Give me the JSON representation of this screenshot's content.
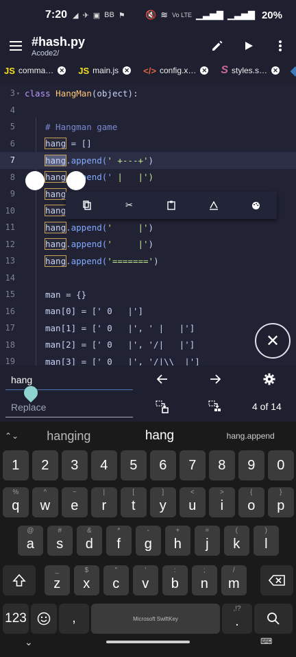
{
  "status": {
    "time": "7:20",
    "left_icons": [
      "◢",
      "✈",
      "▣",
      "ВВ",
      "⚑"
    ],
    "right_small": "Vo LTE",
    "battery": "20%"
  },
  "appbar": {
    "title": "#hash.py",
    "path": "Acode2/"
  },
  "tabs": [
    {
      "icon": "JS",
      "label": "comma…",
      "color": "#f7df1e"
    },
    {
      "icon": "JS",
      "label": "main.js",
      "color": "#f7df1e"
    },
    {
      "icon": "</>",
      "label": "config.x…",
      "color": "#e8603c"
    },
    {
      "icon": "S",
      "label": "styles.s…",
      "color": "#cd6799"
    },
    {
      "icon": "◆",
      "label": "",
      "color": "#3d7ab8"
    }
  ],
  "editor": {
    "lines": [
      {
        "n": "3",
        "fold": "▾"
      },
      {
        "n": "4"
      },
      {
        "n": "5"
      },
      {
        "n": "6"
      },
      {
        "n": "7"
      },
      {
        "n": "8"
      },
      {
        "n": "9"
      },
      {
        "n": "10"
      },
      {
        "n": "11"
      },
      {
        "n": "12"
      },
      {
        "n": "13"
      },
      {
        "n": "14"
      },
      {
        "n": "15"
      },
      {
        "n": "16"
      },
      {
        "n": "17"
      },
      {
        "n": "18"
      },
      {
        "n": "19"
      }
    ],
    "code": {
      "l3_kw": "class",
      "l3_cls": "HangMan",
      "l3_rest": "(object):",
      "l5": "# Hangman game",
      "hang": "hang",
      "l6_rest": " = []",
      "append": ".append(",
      "s7": "' +---+'",
      "s8_a": "' |   |'",
      "s8_hidden": "end('",
      "s8_tail": " |   |')",
      "s11": "'     |'",
      "s12": "'     |'",
      "s13": "'======='",
      "close": ")",
      "l15": "man = {}",
      "l16": "man[0] = [' 0   |']",
      "l17": "man[1] = [' 0   |', ' |   |']",
      "l18": "man[2] = [' 0   |', '/|   |']",
      "l19": "man[3] = [' 0   |', '/|\\\\  |']"
    }
  },
  "context_toolbar": {
    "items": [
      {
        "name": "copy-icon",
        "glyph": "⧉"
      },
      {
        "name": "cut-icon",
        "glyph": "✂"
      },
      {
        "name": "paste-icon",
        "glyph": "📋"
      },
      {
        "name": "select-all-icon",
        "glyph": "A"
      },
      {
        "name": "palette-icon",
        "glyph": "◕"
      }
    ]
  },
  "search": {
    "find_value": "hang",
    "replace_placeholder": "Replace",
    "match_count": "4 of 14"
  },
  "keyboard": {
    "suggestions": [
      "hanging",
      "hang",
      "hang.append"
    ],
    "brand": "Microsoft SwiftKey",
    "num_key": "123",
    "row_numbers": [
      "1",
      "2",
      "3",
      "4",
      "5",
      "6",
      "7",
      "8",
      "9",
      "0"
    ],
    "row1": [
      [
        "%",
        "q"
      ],
      [
        "^",
        "w"
      ],
      [
        "~",
        "e"
      ],
      [
        "|",
        "r"
      ],
      [
        "[",
        "t"
      ],
      [
        "]",
        "y"
      ],
      [
        "<",
        "u"
      ],
      [
        ">",
        "i"
      ],
      [
        "{",
        "o"
      ],
      [
        "}",
        "p"
      ]
    ],
    "row2": [
      [
        "@",
        "a"
      ],
      [
        "#",
        "s"
      ],
      [
        "&",
        "d"
      ],
      [
        "*",
        "f"
      ],
      [
        "-",
        "g"
      ],
      [
        "+",
        "h"
      ],
      [
        "=",
        "j"
      ],
      [
        "(",
        "k"
      ],
      [
        ")",
        "l"
      ]
    ],
    "row3": [
      [
        "_",
        "z"
      ],
      [
        "$",
        "x"
      ],
      [
        "\"",
        "c"
      ],
      [
        "'",
        "v"
      ],
      [
        ":",
        "b"
      ],
      [
        ";",
        "n"
      ],
      [
        "/",
        "m"
      ]
    ],
    "comma": ",",
    "period": ".",
    "period_alt": ",!?"
  }
}
